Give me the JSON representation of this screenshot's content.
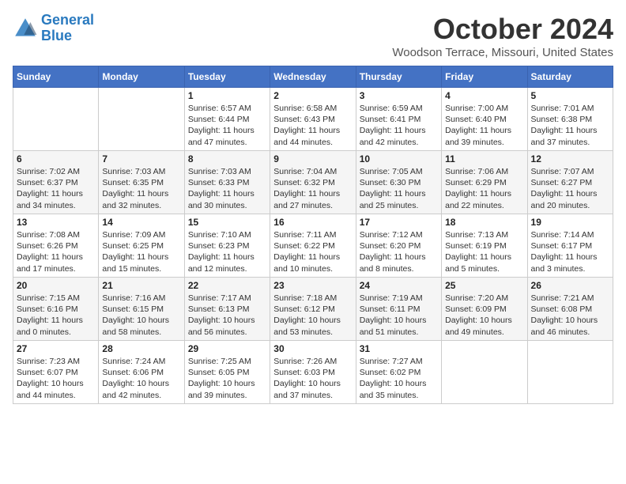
{
  "logo": {
    "line1": "General",
    "line2": "Blue"
  },
  "title": "October 2024",
  "location": "Woodson Terrace, Missouri, United States",
  "weekdays": [
    "Sunday",
    "Monday",
    "Tuesday",
    "Wednesday",
    "Thursday",
    "Friday",
    "Saturday"
  ],
  "weeks": [
    [
      {
        "day": "",
        "sunrise": "",
        "sunset": "",
        "daylight": ""
      },
      {
        "day": "",
        "sunrise": "",
        "sunset": "",
        "daylight": ""
      },
      {
        "day": "1",
        "sunrise": "Sunrise: 6:57 AM",
        "sunset": "Sunset: 6:44 PM",
        "daylight": "Daylight: 11 hours and 47 minutes."
      },
      {
        "day": "2",
        "sunrise": "Sunrise: 6:58 AM",
        "sunset": "Sunset: 6:43 PM",
        "daylight": "Daylight: 11 hours and 44 minutes."
      },
      {
        "day": "3",
        "sunrise": "Sunrise: 6:59 AM",
        "sunset": "Sunset: 6:41 PM",
        "daylight": "Daylight: 11 hours and 42 minutes."
      },
      {
        "day": "4",
        "sunrise": "Sunrise: 7:00 AM",
        "sunset": "Sunset: 6:40 PM",
        "daylight": "Daylight: 11 hours and 39 minutes."
      },
      {
        "day": "5",
        "sunrise": "Sunrise: 7:01 AM",
        "sunset": "Sunset: 6:38 PM",
        "daylight": "Daylight: 11 hours and 37 minutes."
      }
    ],
    [
      {
        "day": "6",
        "sunrise": "Sunrise: 7:02 AM",
        "sunset": "Sunset: 6:37 PM",
        "daylight": "Daylight: 11 hours and 34 minutes."
      },
      {
        "day": "7",
        "sunrise": "Sunrise: 7:03 AM",
        "sunset": "Sunset: 6:35 PM",
        "daylight": "Daylight: 11 hours and 32 minutes."
      },
      {
        "day": "8",
        "sunrise": "Sunrise: 7:03 AM",
        "sunset": "Sunset: 6:33 PM",
        "daylight": "Daylight: 11 hours and 30 minutes."
      },
      {
        "day": "9",
        "sunrise": "Sunrise: 7:04 AM",
        "sunset": "Sunset: 6:32 PM",
        "daylight": "Daylight: 11 hours and 27 minutes."
      },
      {
        "day": "10",
        "sunrise": "Sunrise: 7:05 AM",
        "sunset": "Sunset: 6:30 PM",
        "daylight": "Daylight: 11 hours and 25 minutes."
      },
      {
        "day": "11",
        "sunrise": "Sunrise: 7:06 AM",
        "sunset": "Sunset: 6:29 PM",
        "daylight": "Daylight: 11 hours and 22 minutes."
      },
      {
        "day": "12",
        "sunrise": "Sunrise: 7:07 AM",
        "sunset": "Sunset: 6:27 PM",
        "daylight": "Daylight: 11 hours and 20 minutes."
      }
    ],
    [
      {
        "day": "13",
        "sunrise": "Sunrise: 7:08 AM",
        "sunset": "Sunset: 6:26 PM",
        "daylight": "Daylight: 11 hours and 17 minutes."
      },
      {
        "day": "14",
        "sunrise": "Sunrise: 7:09 AM",
        "sunset": "Sunset: 6:25 PM",
        "daylight": "Daylight: 11 hours and 15 minutes."
      },
      {
        "day": "15",
        "sunrise": "Sunrise: 7:10 AM",
        "sunset": "Sunset: 6:23 PM",
        "daylight": "Daylight: 11 hours and 12 minutes."
      },
      {
        "day": "16",
        "sunrise": "Sunrise: 7:11 AM",
        "sunset": "Sunset: 6:22 PM",
        "daylight": "Daylight: 11 hours and 10 minutes."
      },
      {
        "day": "17",
        "sunrise": "Sunrise: 7:12 AM",
        "sunset": "Sunset: 6:20 PM",
        "daylight": "Daylight: 11 hours and 8 minutes."
      },
      {
        "day": "18",
        "sunrise": "Sunrise: 7:13 AM",
        "sunset": "Sunset: 6:19 PM",
        "daylight": "Daylight: 11 hours and 5 minutes."
      },
      {
        "day": "19",
        "sunrise": "Sunrise: 7:14 AM",
        "sunset": "Sunset: 6:17 PM",
        "daylight": "Daylight: 11 hours and 3 minutes."
      }
    ],
    [
      {
        "day": "20",
        "sunrise": "Sunrise: 7:15 AM",
        "sunset": "Sunset: 6:16 PM",
        "daylight": "Daylight: 11 hours and 0 minutes."
      },
      {
        "day": "21",
        "sunrise": "Sunrise: 7:16 AM",
        "sunset": "Sunset: 6:15 PM",
        "daylight": "Daylight: 10 hours and 58 minutes."
      },
      {
        "day": "22",
        "sunrise": "Sunrise: 7:17 AM",
        "sunset": "Sunset: 6:13 PM",
        "daylight": "Daylight: 10 hours and 56 minutes."
      },
      {
        "day": "23",
        "sunrise": "Sunrise: 7:18 AM",
        "sunset": "Sunset: 6:12 PM",
        "daylight": "Daylight: 10 hours and 53 minutes."
      },
      {
        "day": "24",
        "sunrise": "Sunrise: 7:19 AM",
        "sunset": "Sunset: 6:11 PM",
        "daylight": "Daylight: 10 hours and 51 minutes."
      },
      {
        "day": "25",
        "sunrise": "Sunrise: 7:20 AM",
        "sunset": "Sunset: 6:09 PM",
        "daylight": "Daylight: 10 hours and 49 minutes."
      },
      {
        "day": "26",
        "sunrise": "Sunrise: 7:21 AM",
        "sunset": "Sunset: 6:08 PM",
        "daylight": "Daylight: 10 hours and 46 minutes."
      }
    ],
    [
      {
        "day": "27",
        "sunrise": "Sunrise: 7:23 AM",
        "sunset": "Sunset: 6:07 PM",
        "daylight": "Daylight: 10 hours and 44 minutes."
      },
      {
        "day": "28",
        "sunrise": "Sunrise: 7:24 AM",
        "sunset": "Sunset: 6:06 PM",
        "daylight": "Daylight: 10 hours and 42 minutes."
      },
      {
        "day": "29",
        "sunrise": "Sunrise: 7:25 AM",
        "sunset": "Sunset: 6:05 PM",
        "daylight": "Daylight: 10 hours and 39 minutes."
      },
      {
        "day": "30",
        "sunrise": "Sunrise: 7:26 AM",
        "sunset": "Sunset: 6:03 PM",
        "daylight": "Daylight: 10 hours and 37 minutes."
      },
      {
        "day": "31",
        "sunrise": "Sunrise: 7:27 AM",
        "sunset": "Sunset: 6:02 PM",
        "daylight": "Daylight: 10 hours and 35 minutes."
      },
      {
        "day": "",
        "sunrise": "",
        "sunset": "",
        "daylight": ""
      },
      {
        "day": "",
        "sunrise": "",
        "sunset": "",
        "daylight": ""
      }
    ]
  ]
}
